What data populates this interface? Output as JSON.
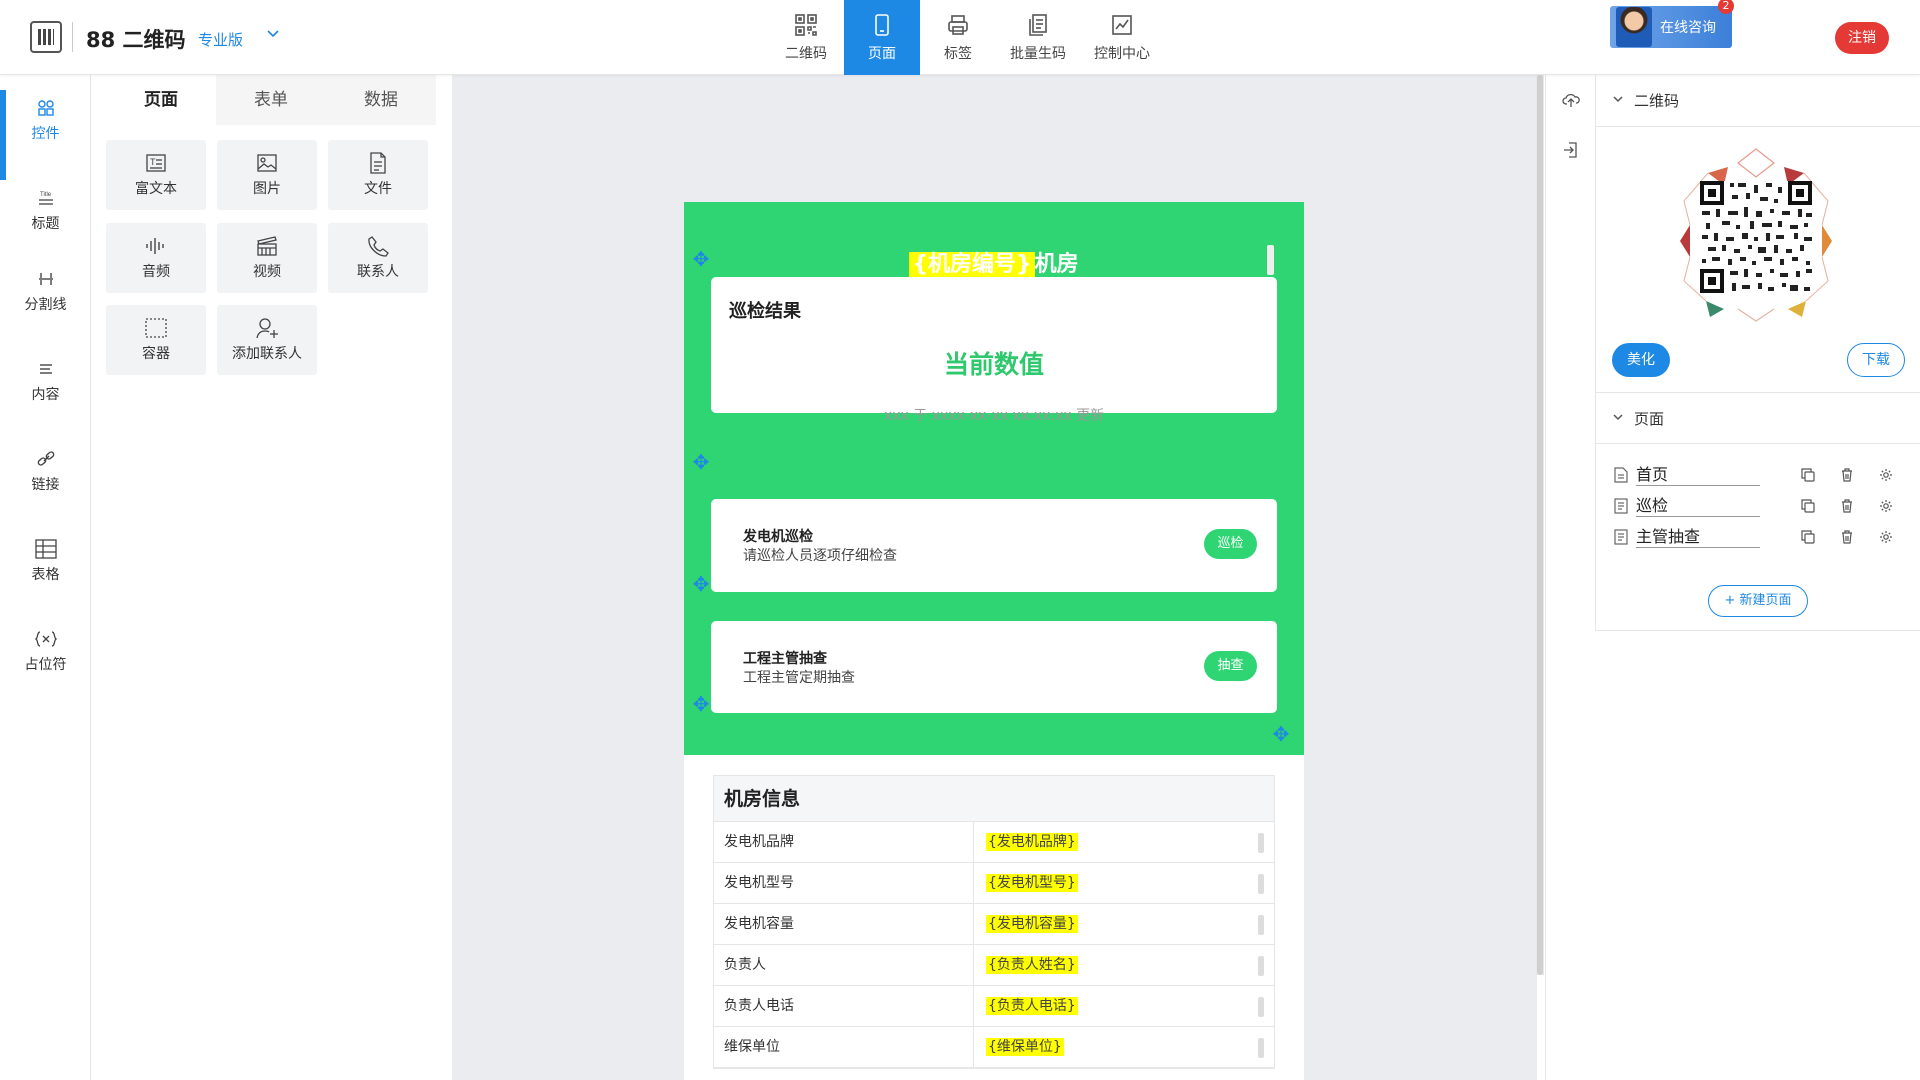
{
  "header": {
    "app_title": "88 二维码",
    "edition": "专业版",
    "nav": [
      {
        "label": "二维码",
        "icon": "qrcode-icon"
      },
      {
        "label": "页面",
        "icon": "phone-icon"
      },
      {
        "label": "标签",
        "icon": "printer-icon"
      },
      {
        "label": "批量生码",
        "icon": "batch-icon"
      },
      {
        "label": "控制中心",
        "icon": "chart-icon"
      }
    ],
    "consult_label": "在线咨询",
    "consult_badge": "2",
    "logout_label": "注销"
  },
  "rail": [
    {
      "label": "控件",
      "icon": "grid-icon"
    },
    {
      "label": "标题",
      "icon": "title-icon"
    },
    {
      "label": "分割线",
      "icon": "divider-icon"
    },
    {
      "label": "内容",
      "icon": "content-icon"
    },
    {
      "label": "链接",
      "icon": "link-icon"
    },
    {
      "label": "表格",
      "icon": "table-icon"
    },
    {
      "label": "占位符",
      "icon": "placeholder-icon"
    }
  ],
  "panel": {
    "tabs": [
      "页面",
      "表单",
      "数据"
    ],
    "tiles": [
      {
        "label": "富文本",
        "icon": "richtext-icon"
      },
      {
        "label": "图片",
        "icon": "image-icon"
      },
      {
        "label": "文件",
        "icon": "file-icon"
      },
      {
        "label": "音频",
        "icon": "audio-icon"
      },
      {
        "label": "视频",
        "icon": "video-icon"
      },
      {
        "label": "联系人",
        "icon": "phone-call-icon"
      },
      {
        "label": "容器",
        "icon": "container-icon"
      },
      {
        "label": "添加联系人",
        "icon": "add-contact-icon"
      }
    ]
  },
  "phone": {
    "title_highlight": "{机房编号}",
    "title_suffix": "机房",
    "result_card": {
      "title": "巡检结果",
      "value": "当前数值",
      "sub": "xxx 于 xxxx-xx-xx xx:xx:xx 更新"
    },
    "tasks": [
      {
        "title": "发电机巡检",
        "desc": "请巡检人员逐项仔细检查",
        "button": "巡检"
      },
      {
        "title": "工程主管抽查",
        "desc": "工程主管定期抽查",
        "button": "抽查"
      }
    ],
    "table": {
      "title": "机房信息",
      "rows": [
        {
          "label": "发电机品牌",
          "value": "{发电机品牌}"
        },
        {
          "label": "发电机型号",
          "value": "{发电机型号}"
        },
        {
          "label": "发电机容量",
          "value": "{发电机容量}"
        },
        {
          "label": "负责人",
          "value": "{负责人姓名}"
        },
        {
          "label": "负责人电话",
          "value": "{负责人电话}"
        },
        {
          "label": "维保单位",
          "value": "{维保单位}"
        }
      ]
    }
  },
  "right_panel": {
    "qr_section_title": "二维码",
    "beautify_label": "美化",
    "download_label": "下载",
    "pages_section_title": "页面",
    "pages": [
      "首页",
      "巡检",
      "主管抽查"
    ],
    "new_page_label": "+ 新建页面"
  },
  "colors": {
    "primary": "#1e88e5",
    "page_green": "#2fd573",
    "value_green": "#2fc86d",
    "highlight": "#ffff00",
    "danger": "#e53935"
  }
}
